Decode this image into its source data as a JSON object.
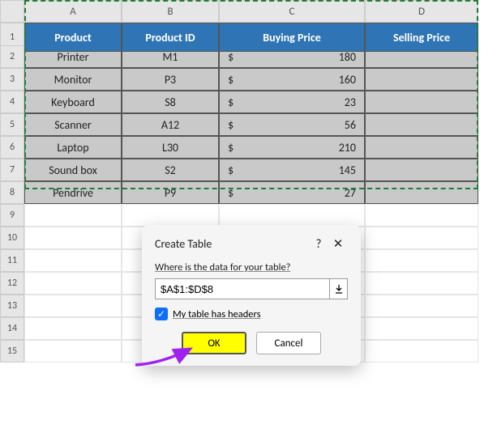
{
  "columns": [
    "A",
    "B",
    "C",
    "D"
  ],
  "row_numbers": [
    1,
    2,
    3,
    4,
    5,
    6,
    7,
    8,
    9,
    10,
    11,
    12,
    13,
    14,
    15
  ],
  "headers": {
    "product": "Product",
    "product_id": "Product ID",
    "buying_price": "Buying Price",
    "selling_price": "Selling Price"
  },
  "rows": [
    {
      "product": "Printer",
      "id": "M1",
      "price": 180
    },
    {
      "product": "Monitor",
      "id": "P3",
      "price": 160
    },
    {
      "product": "Keyboard",
      "id": "S8",
      "price": 23
    },
    {
      "product": "Scanner",
      "id": "A12",
      "price": 56
    },
    {
      "product": "Laptop",
      "id": "L30",
      "price": 210
    },
    {
      "product": "Sound box",
      "id": "S2",
      "price": 145
    },
    {
      "product": "Pendrive",
      "id": "P9",
      "price": 27
    }
  ],
  "currency": "$",
  "dialog": {
    "title": "Create Table",
    "help": "?",
    "close": "✕",
    "prompt": "Where is the data for your table?",
    "range": "$A$1:$D$8",
    "checkbox_label": "My table has headers",
    "ok": "OK",
    "cancel": "Cancel"
  }
}
